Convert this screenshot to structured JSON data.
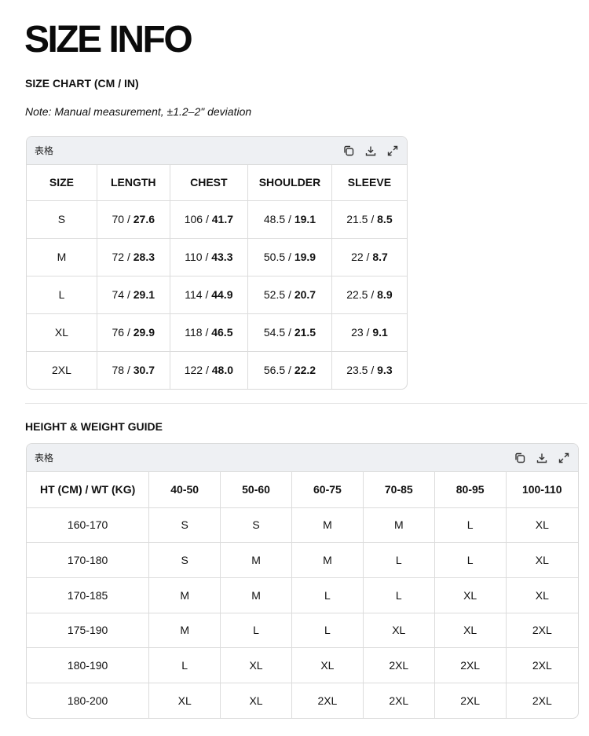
{
  "page": {
    "title": "SIZE INFO",
    "size_chart_title": "SIZE CHART (CM / IN)",
    "note": "Note: Manual measurement, ±1.2–2\" deviation",
    "guide_title": "HEIGHT & WEIGHT GUIDE"
  },
  "table_card": {
    "label": "表格",
    "tools": [
      "copy-icon",
      "download-icon",
      "expand-icon"
    ]
  },
  "size_chart": {
    "headers": [
      "SIZE",
      "LENGTH",
      "CHEST",
      "SHOULDER",
      "SLEEVE"
    ],
    "rows": [
      {
        "size": "S",
        "cells": [
          [
            "70",
            "27.6"
          ],
          [
            "106",
            "41.7"
          ],
          [
            "48.5",
            "19.1"
          ],
          [
            "21.5",
            "8.5"
          ]
        ]
      },
      {
        "size": "M",
        "cells": [
          [
            "72",
            "28.3"
          ],
          [
            "110",
            "43.3"
          ],
          [
            "50.5",
            "19.9"
          ],
          [
            "22",
            "8.7"
          ]
        ]
      },
      {
        "size": "L",
        "cells": [
          [
            "74",
            "29.1"
          ],
          [
            "114",
            "44.9"
          ],
          [
            "52.5",
            "20.7"
          ],
          [
            "22.5",
            "8.9"
          ]
        ]
      },
      {
        "size": "XL",
        "cells": [
          [
            "76",
            "29.9"
          ],
          [
            "118",
            "46.5"
          ],
          [
            "54.5",
            "21.5"
          ],
          [
            "23",
            "9.1"
          ]
        ]
      },
      {
        "size": "2XL",
        "cells": [
          [
            "78",
            "30.7"
          ],
          [
            "122",
            "48.0"
          ],
          [
            "56.5",
            "22.2"
          ],
          [
            "23.5",
            "9.3"
          ]
        ]
      }
    ]
  },
  "guide": {
    "headers": [
      "HT (CM) / WT (KG)",
      "40-50",
      "50-60",
      "60-75",
      "70-85",
      "80-95",
      "100-110"
    ],
    "rows": [
      [
        "160-170",
        "S",
        "S",
        "M",
        "M",
        "L",
        "XL"
      ],
      [
        "170-180",
        "S",
        "M",
        "M",
        "L",
        "L",
        "XL"
      ],
      [
        "170-185",
        "M",
        "M",
        "L",
        "L",
        "XL",
        "XL"
      ],
      [
        "175-190",
        "M",
        "L",
        "L",
        "XL",
        "XL",
        "2XL"
      ],
      [
        "180-190",
        "L",
        "XL",
        "XL",
        "2XL",
        "2XL",
        "2XL"
      ],
      [
        "180-200",
        "XL",
        "XL",
        "2XL",
        "2XL",
        "2XL",
        "2XL"
      ]
    ]
  }
}
